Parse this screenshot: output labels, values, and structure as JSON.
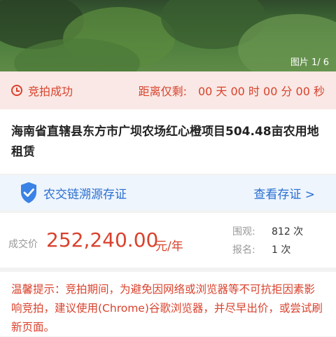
{
  "gallery": {
    "counter": "图片 1/ 6"
  },
  "status": {
    "label": "竞拍成功",
    "countdown": "距离仅剩:　00 天 00 时 00 分 00 秒",
    "accent": "#d9422d"
  },
  "item": {
    "title": "海南省直辖县东方市广坝农场红心橙项目504.48亩农用地租赁"
  },
  "certificate": {
    "label": "农交链溯源存证",
    "link": "查看存证 >",
    "accent": "#2a6fd1"
  },
  "deal": {
    "price_label": "成交价",
    "price": "252,240.00",
    "unit": "元/年",
    "views_label": "围观:",
    "views": "812 次",
    "signups_label": "报名:",
    "signups": "1 次"
  },
  "notice": {
    "text": "温馨提示：竞拍期间，为避免因网络或浏览器等不可抗拒因素影响竞拍，建议使用(Chrome)谷歌浏览器，并尽早出价，或尝试刷新页面。"
  }
}
